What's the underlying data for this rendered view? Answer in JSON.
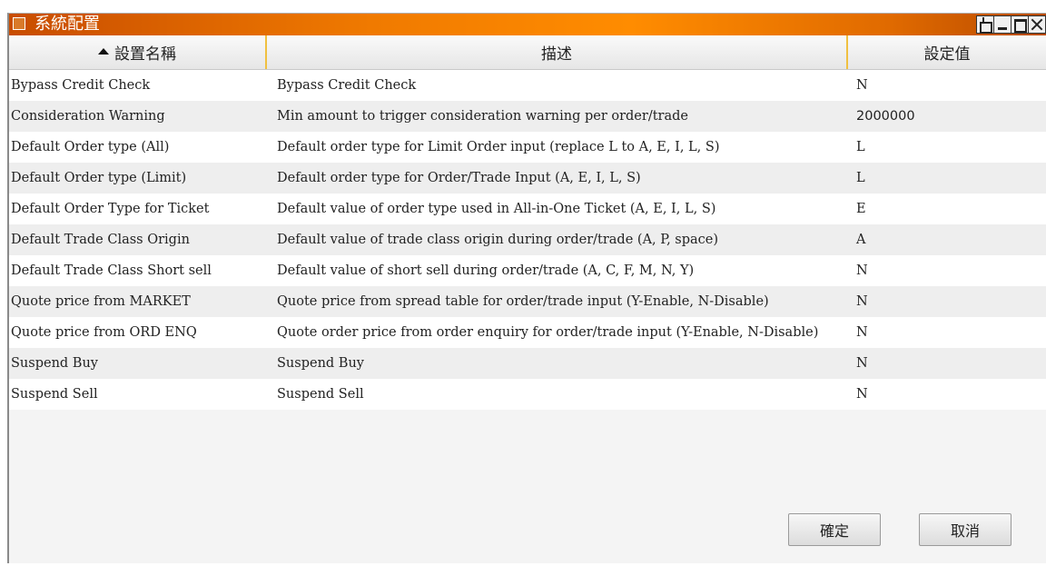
{
  "window": {
    "title": "系統配置",
    "accent_color": "#f07a00"
  },
  "columns": {
    "name": "設置名稱",
    "description": "描述",
    "value": "設定值"
  },
  "rows": [
    {
      "name": "Bypass Credit Check",
      "description": "Bypass Credit Check",
      "value": "N"
    },
    {
      "name": "Consideration Warning",
      "description": "Min amount to trigger consideration warning per order/trade",
      "value": "2000000"
    },
    {
      "name": "Default Order type (All)",
      "description": "Default order type for Limit Order input (replace L to A, E, I, L, S)",
      "value": "L"
    },
    {
      "name": "Default Order type (Limit)",
      "description": "Default order type for Order/Trade Input (A, E, I, L, S)",
      "value": "L"
    },
    {
      "name": "Default Order Type for Ticket",
      "description": "Default value of order type used in All-in-One Ticket (A, E, I, L, S)",
      "value": "E"
    },
    {
      "name": "Default Trade Class Origin",
      "description": "Default value of trade class origin during order/trade (A, P, space)",
      "value": "A"
    },
    {
      "name": "Default Trade Class Short sell",
      "description": "Default value of short sell during order/trade (A, C, F, M, N, Y)",
      "value": "N"
    },
    {
      "name": "Quote price from MARKET",
      "description": "Quote price from spread table for order/trade input (Y-Enable, N-Disable)",
      "value": "N"
    },
    {
      "name": "Quote price from ORD ENQ",
      "description": "Quote order price from order enquiry for order/trade input (Y-Enable, N-Disable)",
      "value": "N"
    },
    {
      "name": "Suspend Buy",
      "description": "Suspend Buy",
      "value": "N"
    },
    {
      "name": "Suspend Sell",
      "description": "Suspend Sell",
      "value": "N"
    }
  ],
  "buttons": {
    "ok": "確定",
    "cancel": "取消"
  }
}
